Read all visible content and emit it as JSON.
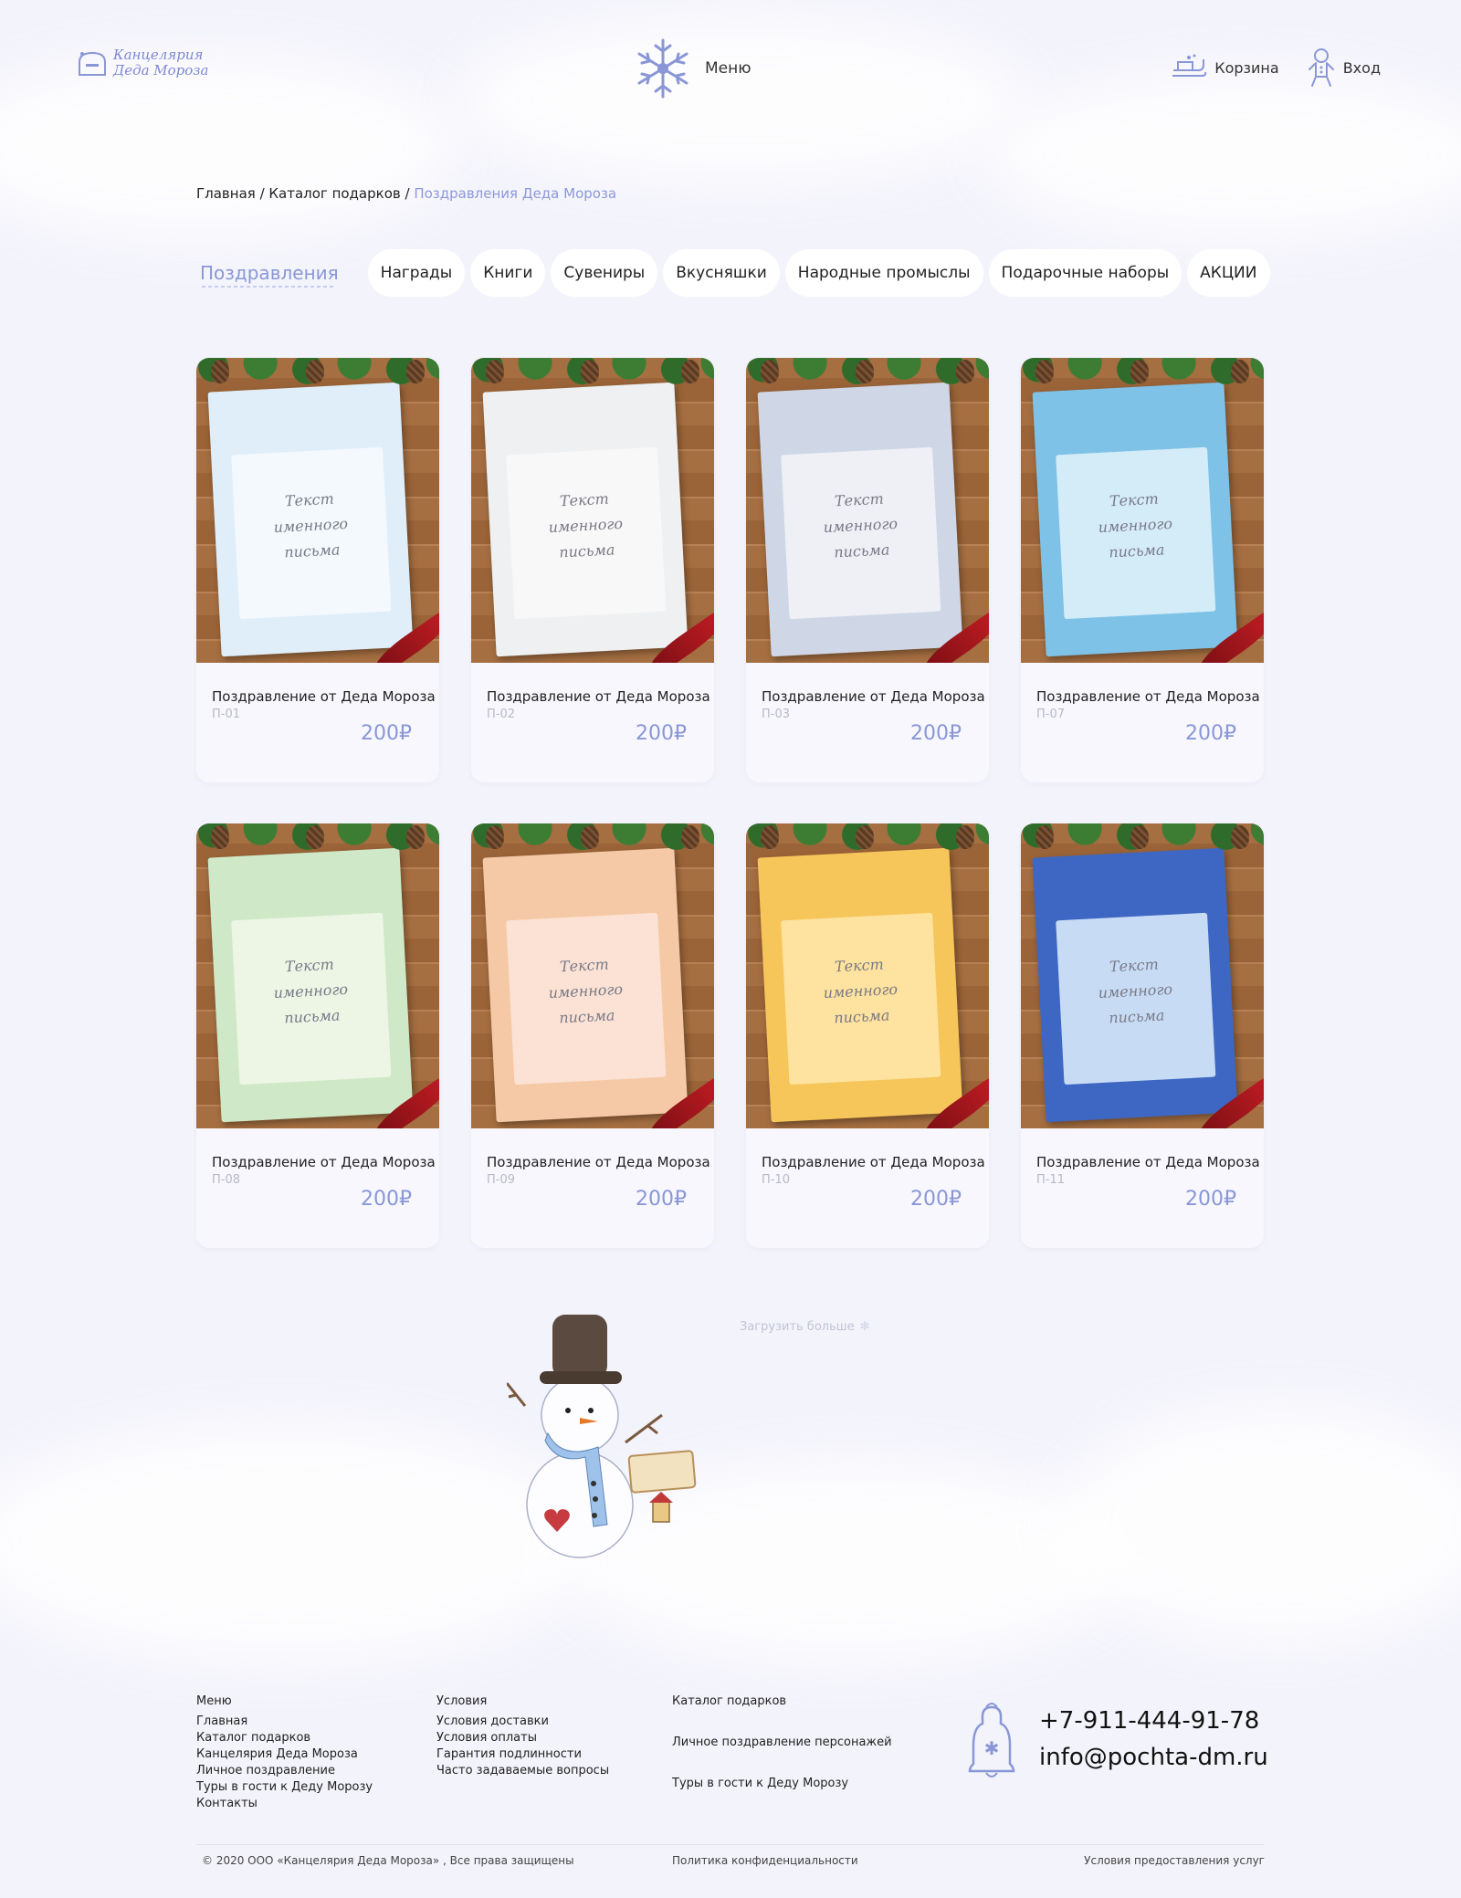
{
  "header": {
    "logo_line1": "Канцелярия",
    "logo_line2": "Деда Мороза",
    "menu_label": "Меню",
    "cart_label": "Корзина",
    "login_label": "Вход"
  },
  "breadcrumb": {
    "home": "Главная",
    "sep1": " / ",
    "catalog": "Каталог подарков",
    "sep2": " / ",
    "current": "Поздравления Деда Мороза"
  },
  "tabs": [
    {
      "label": "Поздравления",
      "active": true
    },
    {
      "label": "Награды"
    },
    {
      "label": "Книги"
    },
    {
      "label": "Сувениры"
    },
    {
      "label": "Вкусняшки"
    },
    {
      "label": "Народные промыслы"
    },
    {
      "label": "Подарочные наборы"
    },
    {
      "label": "АКЦИИ"
    }
  ],
  "sheet_text": [
    "Текст",
    "именного",
    "письма"
  ],
  "products": [
    {
      "title": "Поздравление от Деда Мороза",
      "code": "П-01",
      "price": "200₽",
      "colors": [
        "#dfeef9",
        "#f4f9fe"
      ]
    },
    {
      "title": "Поздравление от Деда Мороза",
      "code": "П-02",
      "price": "200₽",
      "colors": [
        "#eef0f2",
        "#f8f8f8"
      ]
    },
    {
      "title": "Поздравление от Деда Мороза",
      "code": "П-03",
      "price": "200₽",
      "colors": [
        "#cfd6e6",
        "#eef0f6"
      ]
    },
    {
      "title": "Поздравление от Деда Мороза",
      "code": "П-07",
      "price": "200₽",
      "colors": [
        "#7fc2e8",
        "#d4ecf8"
      ]
    },
    {
      "title": "Поздравление от Деда Мороза",
      "code": "П-08",
      "price": "200₽",
      "colors": [
        "#cfe9c8",
        "#edf6e5"
      ]
    },
    {
      "title": "Поздравление от Деда Мороза",
      "code": "П-09",
      "price": "200₽",
      "colors": [
        "#f6c9a6",
        "#fbe2d4"
      ]
    },
    {
      "title": "Поздравление от Деда Мороза",
      "code": "П-10",
      "price": "200₽",
      "colors": [
        "#f7c65a",
        "#fde2a0"
      ]
    },
    {
      "title": "Поздравление от Деда Мороза",
      "code": "П-11",
      "price": "200₽",
      "colors": [
        "#3e67c4",
        "#c7dcf4"
      ]
    }
  ],
  "load_more": "Загрузить больше",
  "footer": {
    "col1": {
      "title": "Меню",
      "links": [
        "Главная",
        "Каталог подарков",
        "Канцелярия Деда Мороза",
        "Личное поздравление",
        "Туры в гости к Деду Морозу",
        "Контакты"
      ]
    },
    "col2": {
      "title": "Условия",
      "links": [
        "Условия доставки",
        "Условия оплаты",
        "Гарантия подлинности",
        "Часто задаваемые вопросы"
      ]
    },
    "col3": {
      "links": [
        "Каталог подарков",
        "Личное поздравление персонажей",
        "Туры в гости к Деду Морозу"
      ]
    },
    "phone": "+7-911-444-91-78",
    "email": "info@pochta-dm.ru",
    "copyright": "© 2020 ООО «Канцелярия Деда Мороза» , Все права защищены",
    "privacy": "Политика конфиденциальности",
    "terms": "Условия предоставления услуг"
  },
  "accent_color": "#8a97d7"
}
